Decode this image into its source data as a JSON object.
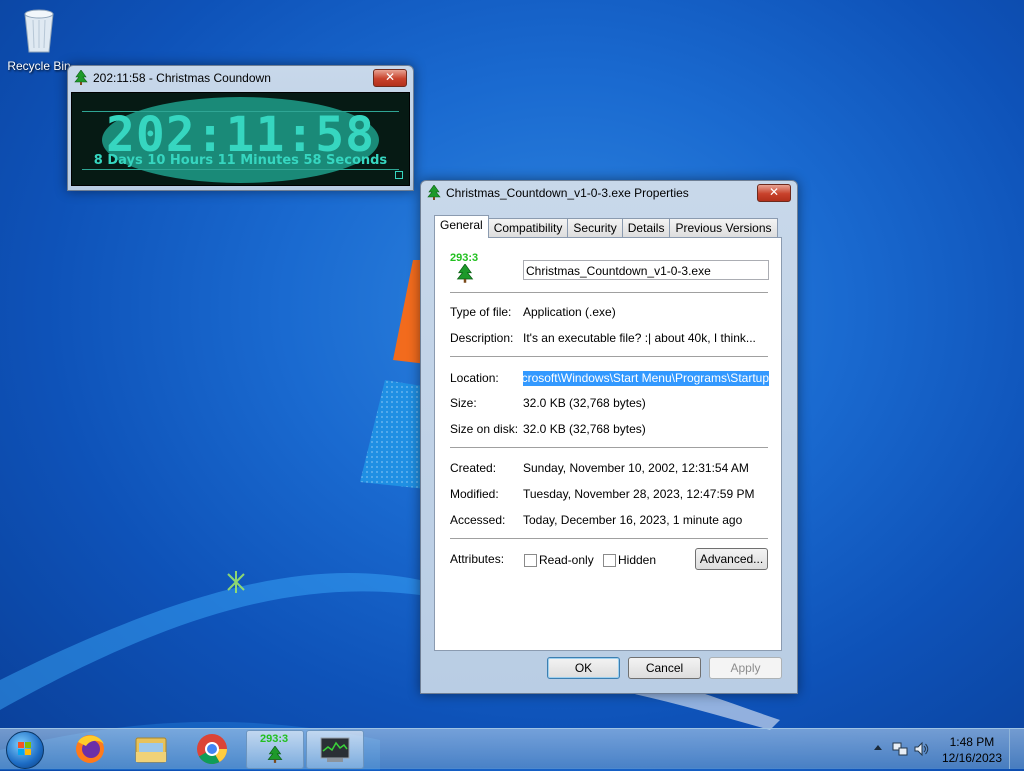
{
  "desktop": {
    "recycle_bin_label": "Recycle Bin"
  },
  "countdown_window": {
    "title": "202:11:58 - Christmas Coundown",
    "close_glyph": "✕",
    "time": "202:11:58",
    "subtitle": "8 Days 10 Hours 11 Minutes 58 Seconds"
  },
  "properties": {
    "title": "Christmas_Countdown_v1-0-3.exe Properties",
    "close_glyph": "✕",
    "tabs": [
      "General",
      "Compatibility",
      "Security",
      "Details",
      "Previous Versions"
    ],
    "icon_text": "293:3",
    "file_name": "Christmas_Countdown_v1-0-3.exe",
    "type_label": "Type of file:",
    "type_value": "Application (.exe)",
    "desc_label": "Description:",
    "desc_value": "It's an executable file? :| about 40k, I think...",
    "location_label": "Location:",
    "location_value": "g\\Microsoft\\Windows\\Start Menu\\Programs\\Startup",
    "size_label": "Size:",
    "size_value": "32.0 KB (32,768 bytes)",
    "size_disk_label": "Size on disk:",
    "size_disk_value": "32.0 KB (32,768 bytes)",
    "created_label": "Created:",
    "created_value": "Sunday, November 10, 2002, 12:31:54 AM",
    "modified_label": "Modified:",
    "modified_value": "Tuesday, November 28, 2023, 12:47:59 PM",
    "accessed_label": "Accessed:",
    "accessed_value": "Today, December 16, 2023, 1 minute ago",
    "attributes_label": "Attributes:",
    "readonly_label": "Read-only",
    "hidden_label": "Hidden",
    "advanced_label": "Advanced...",
    "ok_label": "OK",
    "cancel_label": "Cancel",
    "apply_label": "Apply"
  },
  "taskbar": {
    "countdown_icon_text": "293:3",
    "time": "1:48 PM",
    "date": "12/16/2023"
  }
}
